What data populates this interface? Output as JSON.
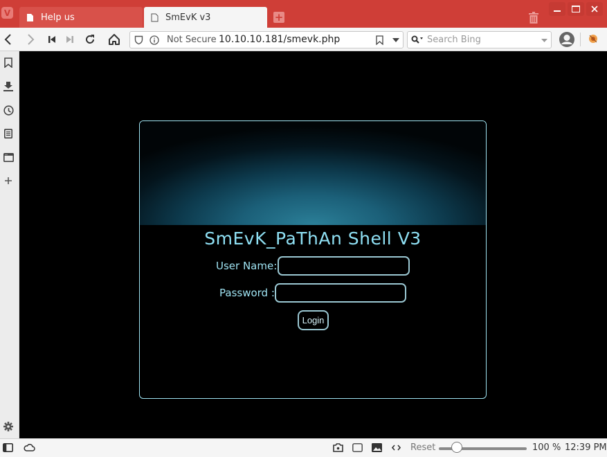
{
  "browser": {
    "tabs": [
      {
        "title": "Help us",
        "active": false
      },
      {
        "title": "SmEvK v3",
        "active": true
      }
    ],
    "address": {
      "security_label": "Not Secure",
      "url": "10.10.10.181/smevk.php"
    },
    "search": {
      "placeholder": "Search Bing"
    },
    "colors": {
      "titlebar": "#cf3e37",
      "accent_text": "#9fe3f2"
    }
  },
  "page": {
    "title": "SmEvK_PaThAn Shell V3",
    "username_label": "User Name:",
    "password_label": "Password :",
    "username_value": "",
    "password_value": "",
    "login_label": "Login"
  },
  "statusbar": {
    "reset_label": "Reset",
    "zoom_percent": 100,
    "zoom_label": "100 %",
    "clock": "12:39 PM"
  }
}
